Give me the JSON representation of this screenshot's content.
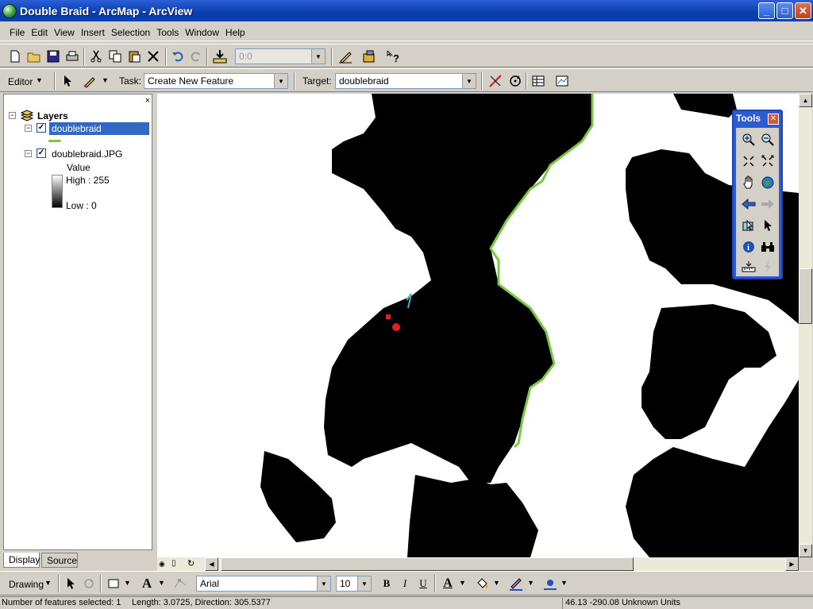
{
  "window": {
    "title": "Double Braid - ArcMap - ArcView",
    "min": "_",
    "max": "□",
    "close": "✕"
  },
  "menu": [
    "File",
    "Edit",
    "View",
    "Insert",
    "Selection",
    "Tools",
    "Window",
    "Help"
  ],
  "standard_toolbar": {
    "scale_value": "0:0"
  },
  "editor_toolbar": {
    "editor_label": "Editor",
    "task_label": "Task:",
    "task_value": "Create New Feature",
    "target_label": "Target:",
    "target_value": "doublebraid"
  },
  "toc": {
    "root": "Layers",
    "layers": [
      {
        "name": "doublebraid",
        "checked": true,
        "selected": true
      },
      {
        "name": "doublebraid.JPG",
        "checked": true,
        "legend_title": "Value",
        "high": "High : 255",
        "low": "Low : 0"
      }
    ],
    "tabs": [
      "Display",
      "Source"
    ]
  },
  "tools_window": {
    "title": "Tools"
  },
  "drawing_toolbar": {
    "drawing_label": "Drawing",
    "font": "Arial",
    "size": "10",
    "bold": "B",
    "italic": "I",
    "underline": "U",
    "font_color_glyph": "A"
  },
  "status": {
    "selected": "Number of features selected: 1",
    "length_dir": "Length: 3.0725, Direction: 305.5377",
    "coords": "46.13  -290.08 Unknown Units"
  },
  "colors": {
    "title_blue": "#0a3cae",
    "selection_blue": "#316ac5",
    "green_line": "#7ac943",
    "sketch_red": "#e02020",
    "sketch_cyan": "#3fb6c8"
  }
}
